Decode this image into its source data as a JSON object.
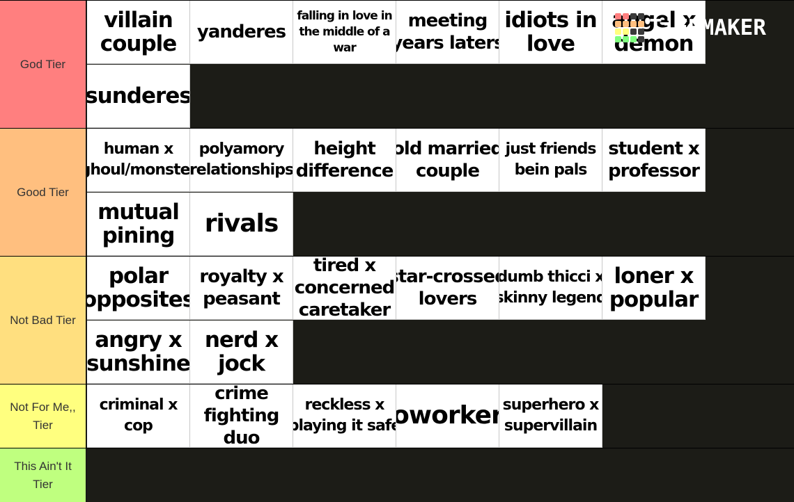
{
  "app": {
    "logo_text": "TiERMAKER",
    "logo_grid_colors": [
      "#ff7f7f",
      "#ff7f7f",
      "#3a3a3a",
      "#3a3a3a",
      "#ffbf7f",
      "#ffbf7f",
      "#ffbf7f",
      "#ffbf7f",
      "#ffff7f",
      "#ffff7f",
      "#3a3a3a",
      "#3a3a3a",
      "#7fff7f",
      "#7fff7f",
      "#7fff7f",
      "#3a3a3a"
    ]
  },
  "tiers": [
    {
      "label": "God Tier",
      "color": "#ff7f7f",
      "items": [
        "villain couple",
        "yanderes",
        "falling in love in the middle of a war",
        "meeting years laters",
        "idiots in love",
        "angel x demon",
        "sunderes"
      ]
    },
    {
      "label": "Good Tier",
      "color": "#ffbf7f",
      "items": [
        "human x ghoul/monster",
        "polyamory relationships",
        "height difference",
        "old married couple",
        "just friends bein pals",
        "student x professor",
        "mutual pining",
        "rivals"
      ]
    },
    {
      "label": "Not Bad Tier",
      "color": "#ffdf7f",
      "items": [
        "polar opposites",
        "royalty x peasant",
        "tired x concerned caretaker",
        "star-crossed lovers",
        "dumb thicci x skinny legend",
        "loner x popular",
        "angry x sunshine",
        "nerd x jock"
      ]
    },
    {
      "label": "Not For Me,, Tier",
      "color": "#ffff7f",
      "items": [
        "criminal x cop",
        "crime fighting duo",
        "reckless x playing it safe",
        "coworkers",
        "superhero x supervillain"
      ]
    },
    {
      "label": "This Ain't It Tier",
      "color": "#bfff7f",
      "items": []
    }
  ],
  "item_display": {
    "0": [
      [
        "villain",
        "couple"
      ],
      [
        "yanderes"
      ],
      [
        "falling in love in",
        "the middle of a",
        "war"
      ],
      [
        "meeting",
        "years laters"
      ],
      [
        "idiots in",
        "love"
      ],
      [
        "angel x",
        "demon"
      ],
      [
        "sunderes"
      ]
    ],
    "1": [
      [
        "human x",
        "ghoul/monster"
      ],
      [
        "polyamory",
        "relationships"
      ],
      [
        "height",
        "difference"
      ],
      [
        "old married",
        "couple"
      ],
      [
        "just friends",
        "bein pals"
      ],
      [
        "student x",
        "professor"
      ],
      [
        "mutual",
        "pining"
      ],
      [
        "rivals"
      ]
    ],
    "2": [
      [
        "polar",
        "opposites"
      ],
      [
        "royalty x",
        "peasant"
      ],
      [
        "tired x",
        "concerned",
        "caretaker"
      ],
      [
        "star-crossed",
        "lovers"
      ],
      [
        "dumb thicci x",
        "skinny legend"
      ],
      [
        "loner x",
        "popular"
      ],
      [
        "angry x",
        "sunshine"
      ],
      [
        "nerd x",
        "jock"
      ]
    ],
    "3": [
      [
        "criminal x",
        "cop"
      ],
      [
        "crime",
        "fighting",
        "duo"
      ],
      [
        "reckless x",
        "playing it safe"
      ],
      [
        "coworkers"
      ],
      [
        "superhero x",
        "supervillain"
      ]
    ]
  }
}
